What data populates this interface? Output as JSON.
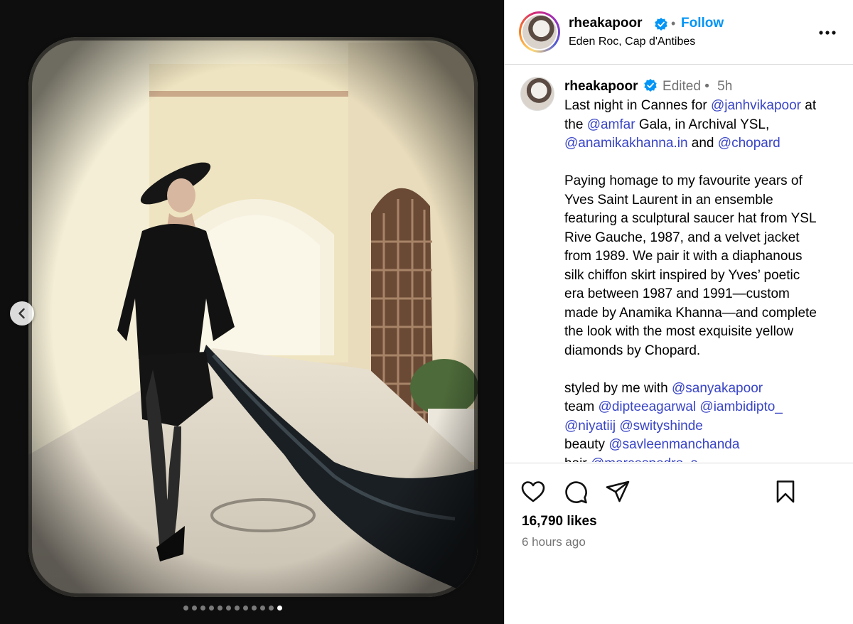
{
  "header": {
    "username": "rheakapoor",
    "separator": "•",
    "follow_label": "Follow",
    "location": "Eden Roc, Cap d'Antibes"
  },
  "caption": {
    "username": "rheakapoor",
    "edited_label": "Edited",
    "separator": "•",
    "age": "5h",
    "lines": [
      [
        {
          "t": "Last night in Cannes for "
        },
        {
          "t": "@janhvikapoor",
          "m": true
        },
        {
          "t": " at"
        }
      ],
      [
        {
          "t": "the "
        },
        {
          "t": "@amfar",
          "m": true
        },
        {
          "t": " Gala, in Archival YSL,"
        }
      ],
      [
        {
          "t": "@anamikakhanna.in",
          "m": true
        },
        {
          "t": " and "
        },
        {
          "t": "@chopard",
          "m": true
        }
      ],
      [],
      [
        {
          "t": "Paying homage to my favourite years of"
        }
      ],
      [
        {
          "t": "Yves Saint Laurent in an ensemble"
        }
      ],
      [
        {
          "t": "featuring a sculptural saucer hat from YSL"
        }
      ],
      [
        {
          "t": "Rive Gauche, 1987, and a velvet jacket"
        }
      ],
      [
        {
          "t": "from 1989. We pair it with a diaphanous"
        }
      ],
      [
        {
          "t": "silk chiffon skirt inspired by Yves’ poetic"
        }
      ],
      [
        {
          "t": "era between 1987 and 1991—custom"
        }
      ],
      [
        {
          "t": "made by Anamika Khanna—and complete"
        }
      ],
      [
        {
          "t": "the look with the most exquisite yellow"
        }
      ],
      [
        {
          "t": "diamonds by Chopard."
        }
      ],
      [],
      [
        {
          "t": "styled by me with "
        },
        {
          "t": "@sanyakapoor",
          "m": true
        }
      ],
      [
        {
          "t": "team "
        },
        {
          "t": "@dipteeagarwal",
          "m": true
        },
        {
          "t": " "
        },
        {
          "t": "@iambidipto_",
          "m": true
        }
      ],
      [
        {
          "t": "@niyatiij",
          "m": true
        },
        {
          "t": " "
        },
        {
          "t": "@swityshinde",
          "m": true
        }
      ],
      [
        {
          "t": "beauty "
        },
        {
          "t": "@savleenmanchanda",
          "m": true
        }
      ],
      [
        {
          "t": "hair "
        },
        {
          "t": "@marcespedro_s",
          "m": true
        }
      ]
    ]
  },
  "actions": {
    "icons": [
      "heart-icon",
      "comment-icon",
      "share-icon",
      "bookmark-icon"
    ],
    "likes": "16,790 likes",
    "time_ago": "6 hours ago"
  },
  "carousel": {
    "total": 12,
    "active_index": 11
  },
  "colors": {
    "follow": "#0095f6",
    "mention": "#3844c6",
    "verified": "#0095f6",
    "muted": "#737373"
  }
}
